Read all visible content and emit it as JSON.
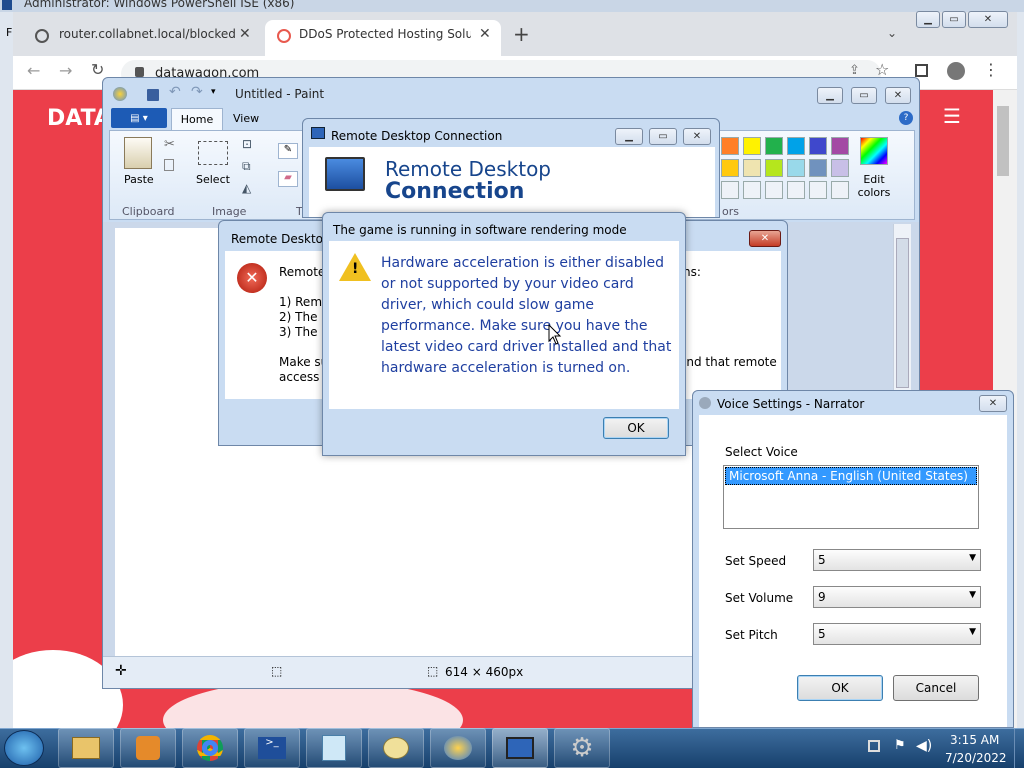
{
  "powershell": {
    "title": "Administrator: Windows PowerShell ISE (x86)",
    "side_letter": "F"
  },
  "browser": {
    "tabs": [
      {
        "label": "router.collabnet.local/blocked.ph"
      },
      {
        "label": "DDoS Protected Hosting Solution"
      }
    ],
    "url": "datawagon.com",
    "site_logo": "DATA"
  },
  "paint": {
    "title": "Untitled - Paint",
    "tabs": [
      "Home",
      "View"
    ],
    "groups": {
      "clipboard": "Clipboard",
      "image": "Image",
      "tools_partial": "T",
      "colors_partial": "ors"
    },
    "paste_label": "Paste",
    "select_label": "Select",
    "edit_colors_label": "Edit colors",
    "status_size": "614 × 460px",
    "colors": [
      "#ff7f27",
      "#fff200",
      "#22b14c",
      "#00a2e8",
      "#3f48cc",
      "#a349a4",
      "#ffc90e",
      "#efe4b0",
      "#b5e61d",
      "#99d9ea",
      "#7092be",
      "#c8bfe7"
    ]
  },
  "rdc": {
    "title": "Remote Desktop Connection",
    "banner_line1": "Remote Desktop",
    "banner_line2": "Connection"
  },
  "rd_error": {
    "title": "Remote Desktop",
    "line1": "Remote",
    "line1_right": "ns:",
    "item1": "1) Remo",
    "item2": "2) The re",
    "item3": "3) The re",
    "make_su": "Make su",
    "make_su_right": "and that remote",
    "access_is": "access is"
  },
  "game_dialog": {
    "title": "The game is running in software rendering mode",
    "message": "Hardware acceleration is either disabled or not supported by your video card driver, which could slow game performance. Make sure you have the latest video card driver installed and that hardware acceleration is turned on.",
    "ok_label": "OK"
  },
  "narrator": {
    "title": "Voice Settings - Narrator",
    "select_voice_label": "Select Voice",
    "voices": [
      "Microsoft Anna - English (United States)"
    ],
    "speed_label": "Set Speed",
    "speed_value": "5",
    "volume_label": "Set Volume",
    "volume_value": "9",
    "pitch_label": "Set Pitch",
    "pitch_value": "5",
    "ok_label": "OK",
    "cancel_label": "Cancel"
  },
  "taskbar": {
    "time": "3:15 AM",
    "date": "7/20/2022"
  }
}
